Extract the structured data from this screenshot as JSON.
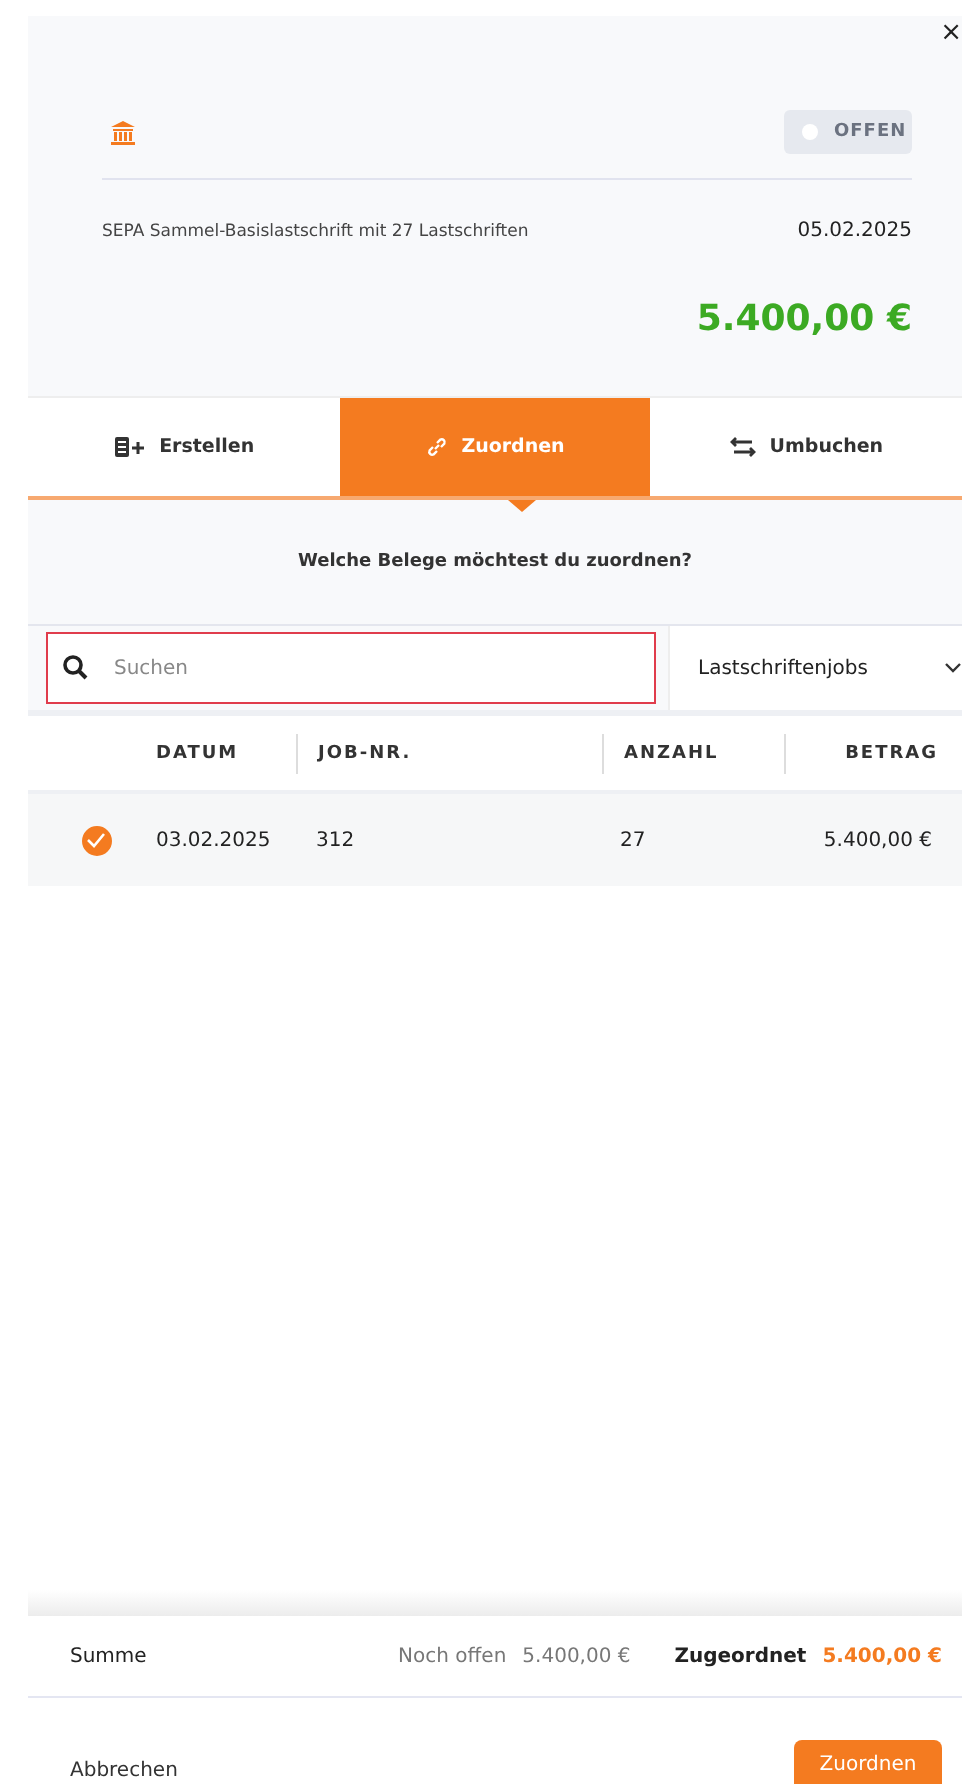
{
  "close_label": "×",
  "header": {
    "status": "OFFEN",
    "description": "SEPA Sammel-Basislastschrift mit 27 Lastschriften",
    "date": "05.02.2025",
    "amount": "5.400,00 €"
  },
  "tabs": [
    {
      "label": "Erstellen",
      "kind": "create",
      "selected": false
    },
    {
      "label": "Zuordnen",
      "kind": "link",
      "selected": true
    },
    {
      "label": "Umbuchen",
      "kind": "transfer",
      "selected": false
    }
  ],
  "question": "Welche Belege möchtest du zuordnen?",
  "search": {
    "placeholder": "Suchen"
  },
  "filter": {
    "value": "Lastschriftenjobs"
  },
  "table": {
    "columns": [
      "DATUM",
      "JOB-NR.",
      "ANZAHL",
      "BETRAG"
    ],
    "rows": [
      {
        "checked": true,
        "cells": [
          "03.02.2025",
          "312",
          "27",
          "5.400,00 €"
        ]
      }
    ]
  },
  "summary": {
    "label": "Summe",
    "open_label": "Noch offen",
    "open_value": "5.400,00 €",
    "assigned_label": "Zugeordnet",
    "assigned_value": "5.400,00 €"
  },
  "buttons": {
    "cancel": "Abbrechen",
    "confirm": "Zuordnen"
  }
}
